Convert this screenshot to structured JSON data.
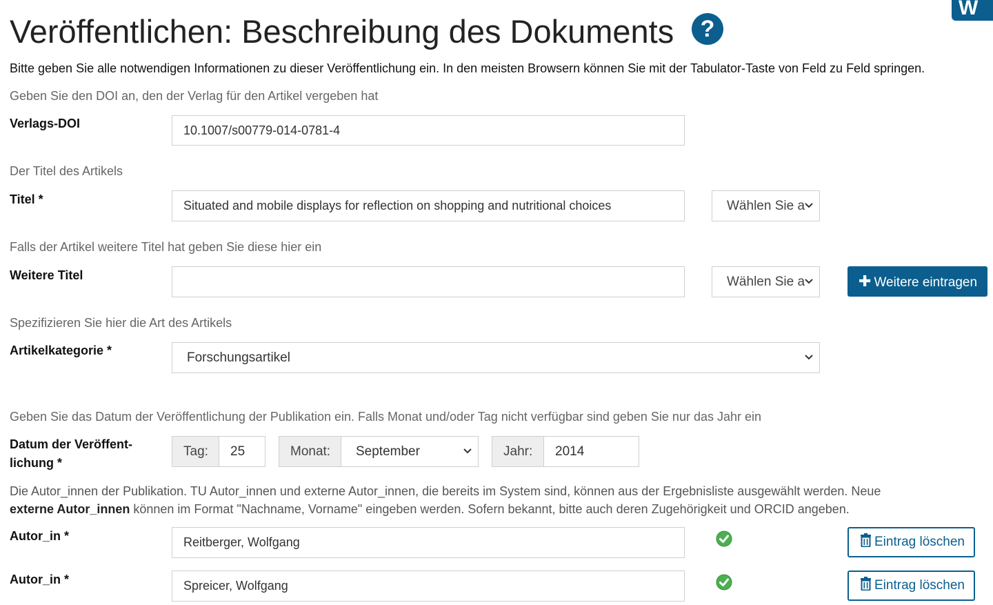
{
  "header": {
    "title": "Veröffentlichen: Beschreibung des Dokuments",
    "help_icon": "question-circle-icon",
    "logo_text": "W I"
  },
  "intro": "Bitte geben Sie alle notwendigen Informationen zu dieser Veröffentlichung ein. In den meisten Browsern können Sie mit der Tabulator-Taste von Feld zu Feld springen.",
  "doi": {
    "hint": "Geben Sie den DOI an, den der Verlag für den Artikel vergeben hat",
    "label": "Verlags-DOI",
    "value": "10.1007/s00779-014-0781-4"
  },
  "title_field": {
    "hint": "Der Titel des Artikels",
    "label": "Titel *",
    "value": "Situated and mobile displays for reflection on shopping and nutritional choices",
    "language_select": "Wählen Sie a"
  },
  "more_titles": {
    "hint": "Falls der Artikel weitere Titel hat geben Sie diese hier ein",
    "label": "Weitere Titel",
    "value": "",
    "language_select": "Wählen Sie a",
    "add_button": "Weitere eintragen"
  },
  "category": {
    "hint": "Spezifizieren Sie hier die Art des Artikels",
    "label": "Artikelkategorie *",
    "value": "Forschungsartikel"
  },
  "date": {
    "hint": "Geben Sie das Datum der Veröffentlichung der Publikation ein. Falls Monat und/oder Tag nicht verfügbar sind geben Sie nur das Jahr ein",
    "label_line1": "Datum der Veröffent-",
    "label_line2": "lichung *",
    "day_label": "Tag:",
    "day_value": "25",
    "month_label": "Monat:",
    "month_value": "September",
    "year_label": "Jahr:",
    "year_value": "2014"
  },
  "authors": {
    "desc_part1": "Die Autor_innen der Publikation. TU Autor_innen und externe Autor_innen, die bereits im System sind, können aus der Ergebnisliste ausgewählt werden. Neue ",
    "desc_bold": "externe Autor_innen",
    "desc_part2": " können im Format \"Nachname, Vorname\" eingeben werden. Sofern bekannt, bitte auch deren Zugehörigkeit und ORCID angeben.",
    "items": [
      {
        "label": "Autor_in *",
        "value": "Reitberger, Wolfgang",
        "delete_label": "Eintrag löschen"
      },
      {
        "label": "Autor_in *",
        "value": "Spreicer, Wolfgang",
        "delete_label": "Eintrag löschen"
      }
    ]
  },
  "colors": {
    "primary": "#0b5e8e",
    "check": "#4caf50"
  }
}
